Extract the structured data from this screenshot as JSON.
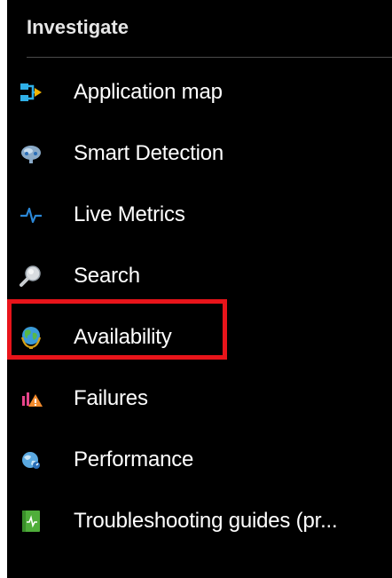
{
  "section": {
    "title": "Investigate"
  },
  "nav": {
    "items": [
      {
        "label": "Application map",
        "icon": "application-map-icon"
      },
      {
        "label": "Smart Detection",
        "icon": "smart-detection-icon"
      },
      {
        "label": "Live Metrics",
        "icon": "live-metrics-icon"
      },
      {
        "label": "Search",
        "icon": "search-icon"
      },
      {
        "label": "Availability",
        "icon": "globe-icon",
        "highlighted": true
      },
      {
        "label": "Failures",
        "icon": "failures-icon"
      },
      {
        "label": "Performance",
        "icon": "performance-icon"
      },
      {
        "label": "Troubleshooting guides (pr...",
        "icon": "troubleshooting-guide-icon"
      }
    ]
  },
  "colors": {
    "background": "#000000",
    "text": "#ffffff",
    "highlight": "#e8141a",
    "accent_blue": "#2b88d8"
  }
}
